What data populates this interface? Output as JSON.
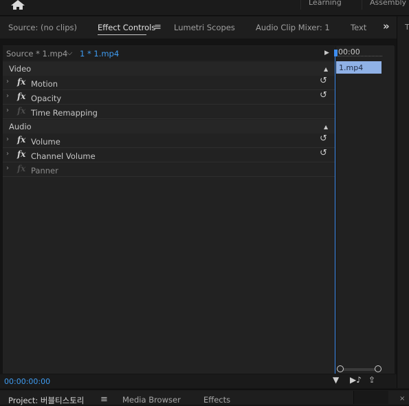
{
  "workspaces": {
    "learning": "Learning",
    "assembly": "Assembly"
  },
  "panel_tabs": {
    "source": "Source: (no clips)",
    "effect_controls": "Effect Controls",
    "lumetri_scopes": "Lumetri Scopes",
    "audio_clip_mixer": "Audio Clip Mixer: 1",
    "text": "Text",
    "right_panel_letter": "T"
  },
  "clip_bar": {
    "source_clip": "Source * 1.mp4",
    "active_clip": "1 * 1.mp4"
  },
  "sections": {
    "video": {
      "label": "Video",
      "effects": [
        "Motion",
        "Opacity",
        "Time Remapping"
      ]
    },
    "audio": {
      "label": "Audio",
      "effects": [
        "Volume",
        "Channel Volume",
        "Panner"
      ]
    }
  },
  "mini_timeline": {
    "time": "00:00",
    "clip_label": "1.mp4"
  },
  "status": {
    "timecode": "00:00:00:00"
  },
  "lower_tabs": {
    "project": "Project: 버블티스토리",
    "media_browser": "Media Browser",
    "effects": "Effects"
  },
  "icons": {
    "home": "home-icon",
    "menu": "hamburger-menu-icon",
    "overflow": "double-chevron-right-icon",
    "fx": "fx-icon",
    "reset": "reset-icon",
    "filter": "filter-icon",
    "loop_audio": "play-audio-icon",
    "export": "export-icon"
  },
  "colors": {
    "accent": "#3f9cf2",
    "clip_block": "#8fb1e6",
    "panel_bg": "#222222"
  }
}
